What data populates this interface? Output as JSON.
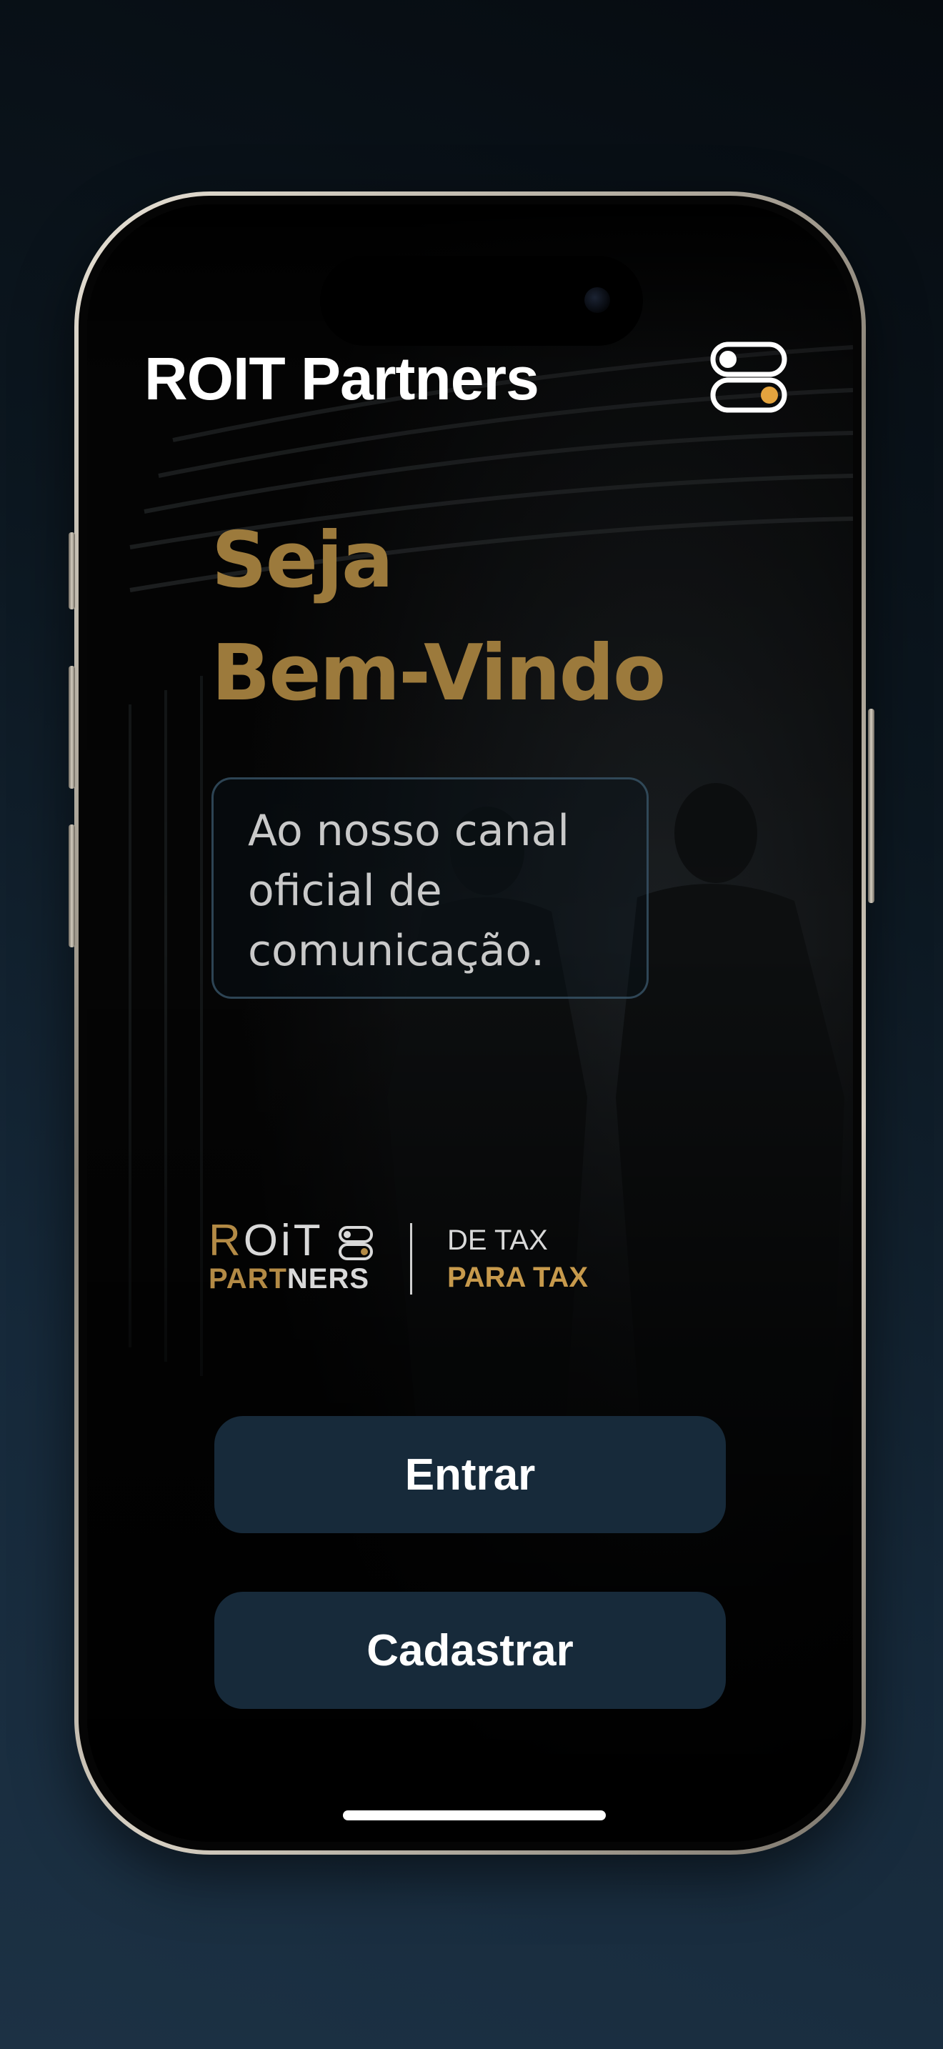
{
  "header": {
    "app_title": "ROIT Partners",
    "menu_icon": "toggle-switch-icon"
  },
  "welcome": {
    "line1": "Seja",
    "line2": "Bem-Vindo"
  },
  "info": {
    "text": "Ao nosso canal oficial de comunicação."
  },
  "brand": {
    "roit_first": "R",
    "roit_rest": "OiT",
    "partners_part1": "PART",
    "partners_part2": "NERS",
    "tagline_line1": "DE TAX",
    "tagline_line2": "PARA TAX"
  },
  "actions": {
    "login_label": "Entrar",
    "signup_label": "Cadastrar"
  },
  "colors": {
    "accent_gold": "#9c7a3c",
    "button_bg": "#172a3a",
    "toggle_dot": "#e3a33e"
  }
}
